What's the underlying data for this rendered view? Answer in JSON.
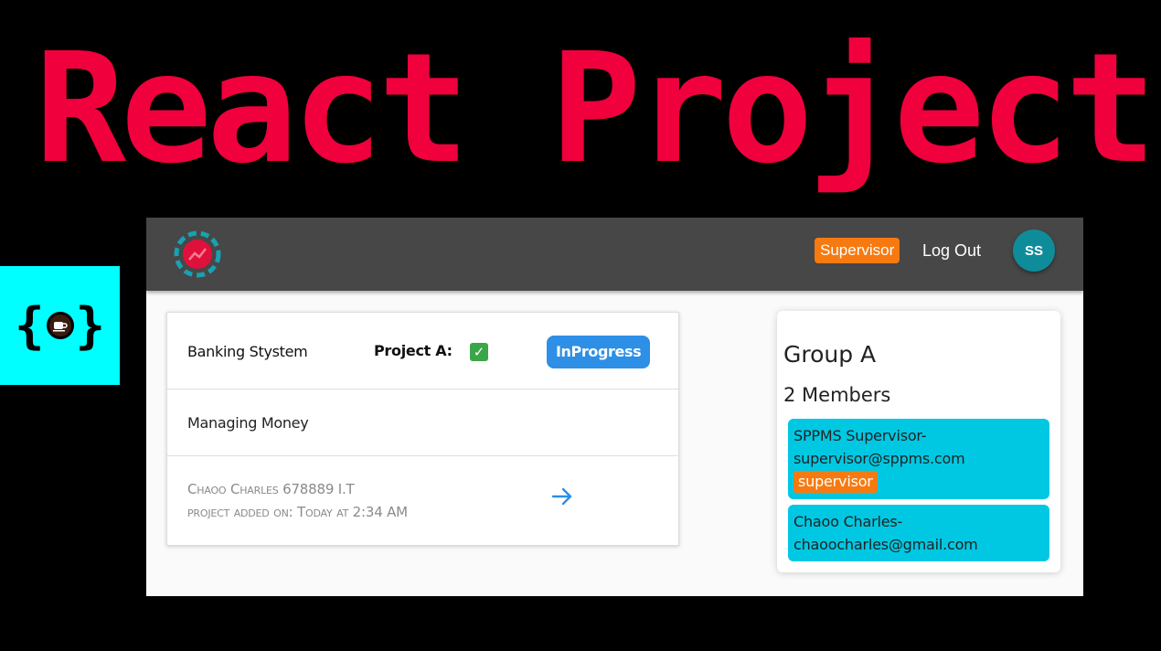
{
  "hero": {
    "title": "React Project"
  },
  "colors": {
    "hero_title": "#f0003c",
    "brand_tile": "#00ffff",
    "navbar": "#474747",
    "role_badge": "#f77a10",
    "avatar": "#0f8c9a",
    "status_button": "#2d8fe6",
    "member_bg": "#00c8e3",
    "checkbox": "#3aa647"
  },
  "brand": {
    "icon": "coffee-cup-braces-icon"
  },
  "navbar": {
    "logo_icon": "chart-ring-logo-icon",
    "role": "Supervisor",
    "logout_label": "Log Out",
    "avatar_initials": "SS"
  },
  "project": {
    "name": "Banking Stystem",
    "project_label": "Project A:",
    "checked": true,
    "status": "InProgress",
    "description": "Managing Money",
    "author_line": "Chaoo Charles 678889 I.T",
    "date_line": "project added on: Today at 2:34 AM",
    "arrow_icon": "arrow-right-icon"
  },
  "group": {
    "title": "Group A",
    "member_count": "2 Members",
    "members": [
      {
        "name_line": "SPPMS Supervisor-",
        "email_line": "supervisor@sppms.com",
        "badge": "supervisor"
      },
      {
        "name_line": "Chaoo Charles-",
        "email_line": "chaoocharles@gmail.com"
      }
    ]
  }
}
